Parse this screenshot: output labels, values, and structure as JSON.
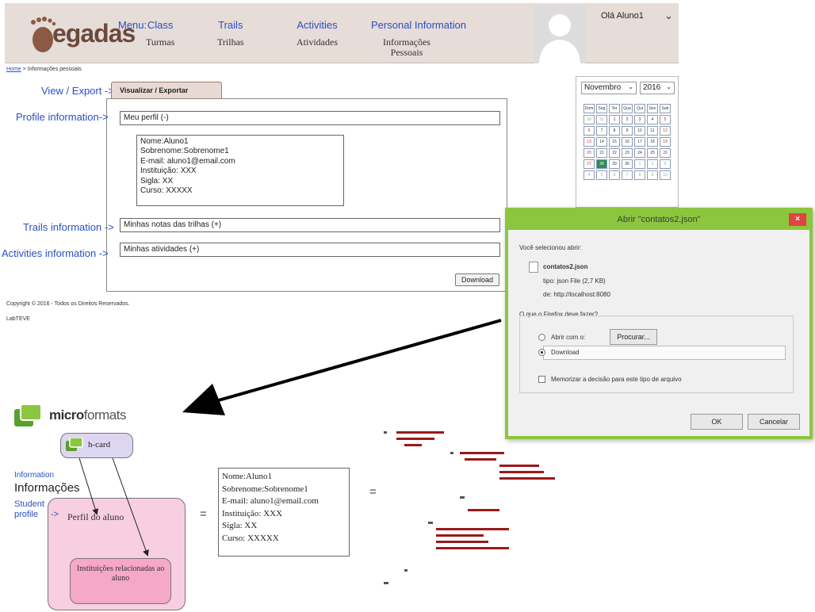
{
  "header": {
    "logo": "egadas",
    "menu_label": "Menu:",
    "menu": [
      {
        "en": "Class",
        "pt": "Turmas"
      },
      {
        "en": "Trails",
        "pt": "Trilhas"
      },
      {
        "en": "Activities",
        "pt": "Atividades"
      },
      {
        "en": "Personal Information",
        "pt": "Informações Pessoais"
      }
    ],
    "user": "Olá Aluno1"
  },
  "breadcrumb": {
    "home": "Home",
    "current": "Informações pessoais"
  },
  "tab": {
    "label": "Visualizar / Exportar",
    "side_label": "View / Export",
    "arrow": "->"
  },
  "rows": {
    "profile": {
      "label": "Profile information",
      "arrow": "->",
      "value": "Meu perfil (-)"
    },
    "trails": {
      "label": "Trails information",
      "arrow": "->",
      "value": "Minhas notas das trilhas (+)"
    },
    "activities": {
      "label": "Activities information",
      "arrow": "->",
      "value": "Minhas atividades (+)"
    }
  },
  "profile_detail": [
    "Nome:Aluno1",
    "Sobrenome:Sobrenome1",
    "E-mail: aluno1@email.com",
    "Instituição: XXX",
    "Sigla: XX",
    "Curso: XXXXX"
  ],
  "download_button": "Download",
  "footer": {
    "copyright": "Copyright © 2016 - Todos os Direitos Reservados.",
    "lab": "LabTEVE"
  },
  "calendar": {
    "month": "Novembro",
    "year": "2016",
    "weekdays": [
      "Dom",
      "Seg",
      "Ter",
      "Qua",
      "Qui",
      "Sex",
      "Sab"
    ],
    "weeks": [
      [
        "30",
        "31",
        "1",
        "2",
        "3",
        "4",
        "5"
      ],
      [
        "6",
        "7",
        "8",
        "9",
        "10",
        "11",
        "12"
      ],
      [
        "13",
        "14",
        "15",
        "16",
        "17",
        "18",
        "19"
      ],
      [
        "20",
        "21",
        "22",
        "23",
        "24",
        "25",
        "26"
      ],
      [
        "27",
        "28",
        "29",
        "30",
        "1",
        "2",
        "3"
      ],
      [
        "4",
        "5",
        "6",
        "7",
        "8",
        "9",
        "10"
      ]
    ],
    "today": "28"
  },
  "dialog": {
    "title": "Abrir \"contatos2.json\"",
    "close": "×",
    "you_selected": "Você selecionou abrir:",
    "filename": "contatos2.json",
    "type_line": "tipo: json File (2,7 KB)",
    "from_line": "de: http://localhost:8080",
    "question": "O que o Firefox deve fazer?",
    "open_with": "Abrir com o:",
    "browse": "Procurar...",
    "download": "Download",
    "remember": "Memorizar a decisão para este tipo de arquivo",
    "ok": "OK",
    "cancel": "Cancelar"
  },
  "diagram": {
    "microformats_bold": "micro",
    "microformats_rest": "formats",
    "hcard": "h-card",
    "info_en": "Information",
    "info_pt": "Informações",
    "student_label": "Student profile",
    "student_arrow": "->",
    "student_box": "Perfil do aluno",
    "institution_box": "Instituições relacionadas ao aluno",
    "equals": "=",
    "detail": [
      "Nome:Aluno1",
      "Sobrenome:Sobrenome1",
      "E-mail: aluno1@email.com",
      "Instituição: XXX",
      "Sigla: XX",
      "Curso: XXXXX"
    ]
  }
}
